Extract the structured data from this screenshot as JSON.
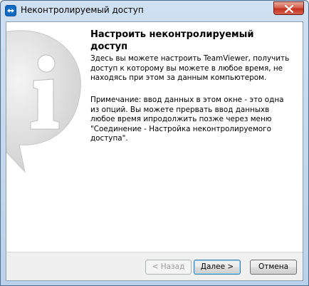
{
  "window": {
    "title": "Неконтролируемый доступ"
  },
  "page": {
    "heading": "Настроить неконтролируемый доступ",
    "paragraph_1": "Здесь вы можете настроить TeamViewer, получить доступ к которому вы можете в любое время, не находясь при этом за данным компьютером.",
    "paragraph_2": "Примечание: ввод данных в этом окне  - это одна из опций. Вы можете прервать ввод данныхв любое время ипродолжить позже через меню \"Соединение - Настройка неконтролируемого доступа\"."
  },
  "buttons": {
    "back": "< Назад",
    "next": "Далее >",
    "cancel": "Отмена"
  },
  "icons": {
    "app": "teamviewer-icon",
    "close": "close-icon",
    "info": "info-icon"
  },
  "colors": {
    "close_button": "#c2331f",
    "titlebar": "#cfe0f1"
  }
}
